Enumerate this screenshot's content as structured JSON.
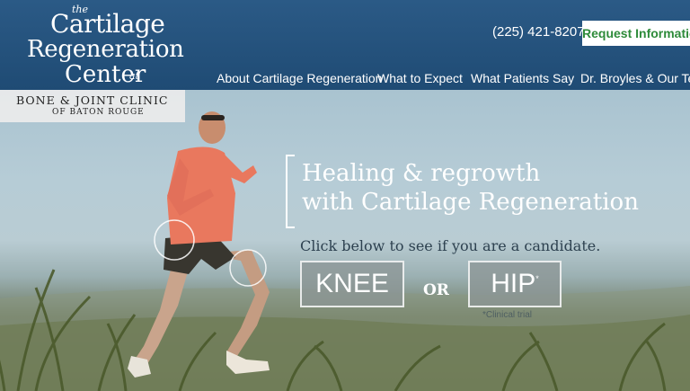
{
  "logo": {
    "the": "the",
    "line1": "Cartilage",
    "line2": "Regeneration",
    "line3": "Center",
    "at": "at"
  },
  "clinic": {
    "name": "BONE & JOINT CLINIC",
    "location": "OF BATON ROUGE"
  },
  "header": {
    "phone": "(225) 421-8207",
    "request_label": "Request Information"
  },
  "nav": [
    {
      "label": "About Cartilage Regeneration"
    },
    {
      "label": "What to Expect"
    },
    {
      "label": "What Patients Say"
    },
    {
      "label": "Dr. Broyles & Our Team"
    }
  ],
  "hero": {
    "headline_1": "Healing & regrowth",
    "headline_2": "with Cartilage Regeneration",
    "subtext": "Click below to see if you are a candidate.",
    "knee_label": "KNEE",
    "or_label": "OR",
    "hip_label": "HIP",
    "hip_marker": "*",
    "trial_note": "*Clinical trial"
  },
  "colors": {
    "header_bg": "#1f4b74",
    "request_text": "#2e8b3a",
    "runner_shirt": "#e9785e"
  }
}
